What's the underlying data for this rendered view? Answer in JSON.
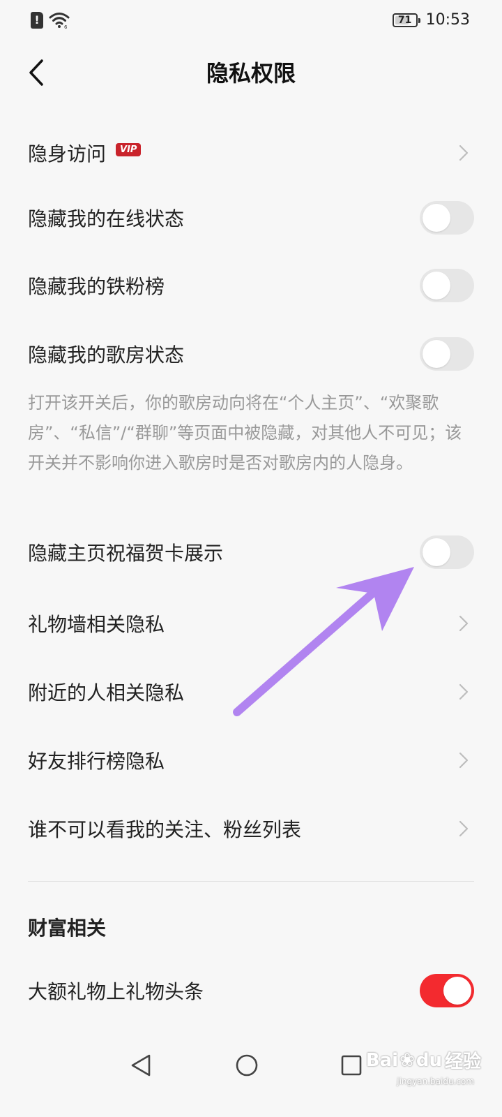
{
  "status_bar": {
    "battery_level": "71",
    "battery_fraction": 0.71,
    "time": "10:53"
  },
  "header": {
    "title": "隐私权限",
    "back_icon": "chevron-left-icon"
  },
  "settings": [
    {
      "label": "隐身访问",
      "badge": "VIP",
      "control": "chevron"
    },
    {
      "label": "隐藏我的在线状态",
      "control": "toggle",
      "on": false
    },
    {
      "label": "隐藏我的铁粉榜",
      "control": "toggle",
      "on": false
    },
    {
      "label": "隐藏我的歌房状态",
      "control": "toggle",
      "on": false
    }
  ],
  "song_room_note": "打开该开关后，你的歌房动向将在“个人主页”、“欢聚歌房”、“私信”/“群聊”等页面中被隐藏，对其他人不可见；该开关并不影响你进入歌房时是否对歌房内的人隐身。",
  "settings_more": [
    {
      "label": "隐藏主页祝福贺卡展示",
      "control": "toggle",
      "on": false
    },
    {
      "label": "礼物墙相关隐私",
      "control": "chevron"
    },
    {
      "label": "附近的人相关隐私",
      "control": "chevron"
    },
    {
      "label": "好友排行榜隐私",
      "control": "chevron"
    },
    {
      "label": "谁不可以看我的关注、粉丝列表",
      "control": "chevron"
    }
  ],
  "wealth_section": {
    "title": "财富相关",
    "items": [
      {
        "label": "大额礼物上礼物头条",
        "control": "toggle",
        "on": true
      }
    ]
  },
  "nav_bar": {
    "back": "triangle-back-icon",
    "home": "circle-home-icon",
    "recent": "square-recent-icon"
  },
  "watermark": {
    "brand": "Bai",
    "brand_tail": "du",
    "brand_cn": "经验",
    "url": "jingyan.baidu.com"
  },
  "colors": {
    "accent": "#f32a2f",
    "vip_badge": "#c9232b",
    "annotation_arrow": "#b184f0",
    "toggle_off": "#e6e6e6"
  }
}
